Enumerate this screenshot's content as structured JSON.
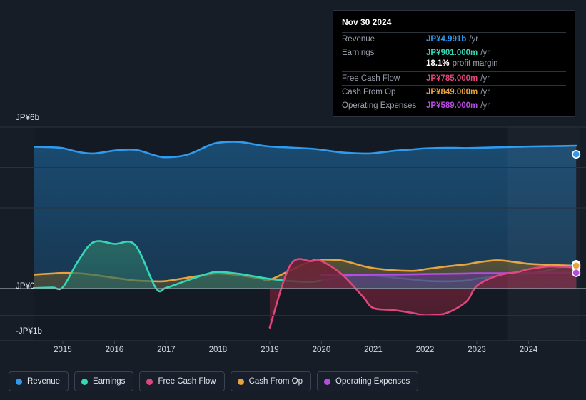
{
  "tooltip": {
    "date": "Nov 30 2024",
    "rows": [
      {
        "label": "Revenue",
        "value": "JP¥4.991b",
        "unit": "/yr",
        "color": "#2e9bf0"
      },
      {
        "label": "Earnings",
        "value": "JP¥901.000m",
        "unit": "/yr",
        "color": "#34d8b4"
      },
      {
        "label": "Free Cash Flow",
        "value": "JP¥785.000m",
        "unit": "/yr",
        "color": "#e0457b"
      },
      {
        "label": "Cash From Op",
        "value": "JP¥849.000m",
        "unit": "/yr",
        "color": "#e8a33d"
      },
      {
        "label": "Operating Expenses",
        "value": "JP¥589.000m",
        "unit": "/yr",
        "color": "#b44de0"
      }
    ],
    "margin_value": "18.1%",
    "margin_text": "profit margin"
  },
  "legend": {
    "items": [
      {
        "label": "Revenue",
        "color": "#2e9bf0"
      },
      {
        "label": "Earnings",
        "color": "#34d8b4"
      },
      {
        "label": "Free Cash Flow",
        "color": "#e0457b"
      },
      {
        "label": "Cash From Op",
        "color": "#e8a33d"
      },
      {
        "label": "Operating Expenses",
        "color": "#b44de0"
      }
    ]
  },
  "chart_data": {
    "type": "area",
    "title": "",
    "xlabel": "",
    "ylabel": "",
    "currency": "JP¥",
    "y_axis": {
      "labels": [
        "JP¥6b",
        "JP¥0",
        "-JP¥1b"
      ],
      "tick_values": [
        6,
        0,
        -1
      ],
      "ylim": [
        -1.35,
        6.55
      ],
      "gridlines": [
        6,
        4.5,
        3,
        0,
        -1
      ]
    },
    "x_axis": {
      "tick_labels": [
        "2015",
        "2016",
        "2017",
        "2018",
        "2019",
        "2020",
        "2021",
        "2022",
        "2023",
        "2024"
      ],
      "tick_values": [
        2015,
        2016,
        2017,
        2018,
        2019,
        2020,
        2021,
        2022,
        2023,
        2024
      ],
      "xlim": [
        2014.45,
        2025.0
      ],
      "forecast_start": 2023.6
    },
    "grid": true,
    "legend_position": "bottom",
    "x": [
      2014.45,
      2014.8,
      2015.0,
      2015.3,
      2015.6,
      2016.0,
      2016.4,
      2016.8,
      2017.0,
      2017.4,
      2017.8,
      2018.0,
      2018.4,
      2018.8,
      2019.0,
      2019.4,
      2019.8,
      2020.0,
      2020.4,
      2020.8,
      2021.0,
      2021.4,
      2021.8,
      2022.0,
      2022.4,
      2022.8,
      2023.0,
      2023.4,
      2023.8,
      2024.0,
      2024.4,
      2024.92
    ],
    "series": [
      {
        "name": "Revenue",
        "color": "#2e9bf0",
        "fill": "#1b4f77",
        "unit": "JP¥b",
        "values": [
          5.27,
          5.25,
          5.22,
          5.08,
          5.02,
          5.13,
          5.16,
          4.94,
          4.88,
          4.97,
          5.3,
          5.42,
          5.45,
          5.33,
          5.28,
          5.24,
          5.2,
          5.16,
          5.06,
          5.02,
          5.03,
          5.12,
          5.18,
          5.21,
          5.23,
          5.22,
          5.23,
          5.25,
          5.27,
          5.28,
          5.29,
          5.31
        ]
      },
      {
        "name": "Earnings",
        "color": "#34d8b4",
        "fill": "#2a6b63",
        "unit": "JP¥b",
        "values": [
          0.02,
          0.04,
          0.05,
          1.03,
          1.73,
          1.66,
          1.62,
          0.02,
          0.03,
          0.3,
          0.55,
          0.62,
          0.55,
          0.42,
          0.36,
          0.28,
          0.25,
          0.3,
          0.44,
          0.5,
          0.49,
          0.41,
          0.33,
          0.29,
          0.27,
          0.3,
          0.37,
          0.44,
          0.47,
          0.53,
          0.68,
          0.9
        ]
      },
      {
        "name": "Free Cash Flow",
        "color": "#e0457b",
        "fill": "#6e2236",
        "unit": "JP¥b",
        "values": [
          null,
          null,
          null,
          null,
          null,
          null,
          null,
          null,
          null,
          null,
          null,
          null,
          null,
          null,
          -1.45,
          0.88,
          1.02,
          1.02,
          0.52,
          -0.3,
          -0.72,
          -0.8,
          -0.92,
          -1.0,
          -0.92,
          -0.48,
          0.1,
          0.48,
          0.62,
          0.72,
          0.82,
          0.785
        ]
      },
      {
        "name": "Cash From Op",
        "color": "#e8a33d",
        "fill": "#5c5233",
        "unit": "JP¥b",
        "values": [
          0.52,
          0.56,
          0.58,
          0.57,
          0.51,
          0.4,
          0.3,
          0.27,
          0.28,
          0.4,
          0.52,
          0.56,
          0.5,
          0.38,
          0.33,
          0.68,
          1.02,
          1.08,
          1.04,
          0.84,
          0.76,
          0.68,
          0.66,
          0.72,
          0.82,
          0.9,
          0.97,
          1.05,
          0.97,
          0.92,
          0.88,
          0.849
        ]
      },
      {
        "name": "Operating Expenses",
        "color": "#b44de0",
        "fill": "#5c3c7a",
        "unit": "JP¥b",
        "values": [
          null,
          null,
          null,
          null,
          null,
          null,
          null,
          null,
          null,
          null,
          null,
          null,
          null,
          null,
          null,
          null,
          null,
          0.5,
          0.51,
          0.51,
          0.52,
          0.52,
          0.53,
          0.54,
          0.55,
          0.56,
          0.57,
          0.57,
          0.58,
          0.585,
          0.587,
          0.589
        ]
      }
    ],
    "end_markers": [
      {
        "series": "Revenue",
        "value": 4.991,
        "color": "#2e9bf0"
      },
      {
        "series": "Earnings",
        "value": 0.901,
        "color": "#34d8b4"
      },
      {
        "series": "Free Cash Flow",
        "value": 0.785,
        "color": "#e0457b"
      },
      {
        "series": "Cash From Op",
        "value": 0.849,
        "color": "#e8a33d"
      },
      {
        "series": "Operating Expenses",
        "value": 0.589,
        "color": "#b44de0"
      }
    ]
  }
}
